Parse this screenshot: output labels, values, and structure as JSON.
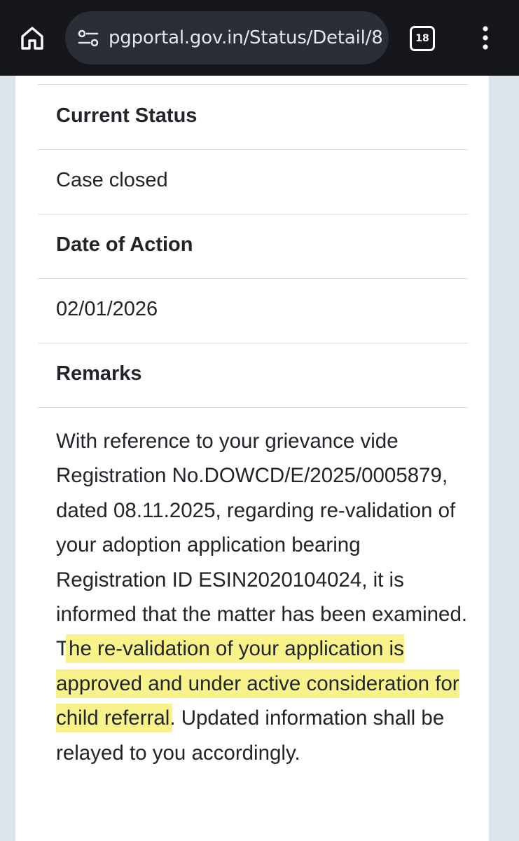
{
  "browser": {
    "url": "pgportal.gov.in/Status/Detail/8",
    "tab_count": "18",
    "icons": {
      "home": "home-icon",
      "site_settings": "site-settings-icon",
      "tabs": "tab-switcher-icon",
      "menu": "more-vert-icon"
    }
  },
  "status_detail": {
    "current_status_label": "Current Status",
    "current_status_value": "Case closed",
    "date_label": "Date of Action",
    "date_value": "02/01/2026",
    "remarks_label": "Remarks",
    "remarks_text_before_highlight": "With reference to your grievance vide Registration No.DOWCD/E/2025/0005879, dated 08.11.2025, regarding re-validation of your adoption application bearing Registration ID ESIN2020104024, it is informed that the matter has been examined. T",
    "remarks_text_highlighted": "he re-validation of your application is approved and under active consideration for child referral",
    "remarks_text_after_highlight": ". Updated information shall be relayed to you accordingly."
  },
  "colors": {
    "topbar_background": "#15171c",
    "urlbar_background": "#2b2e36",
    "page_background": "#dde3ea",
    "card_background": "#ffffff",
    "text": "#212529",
    "highlight": "#f7f38a",
    "divider": "#d8dbe0"
  }
}
